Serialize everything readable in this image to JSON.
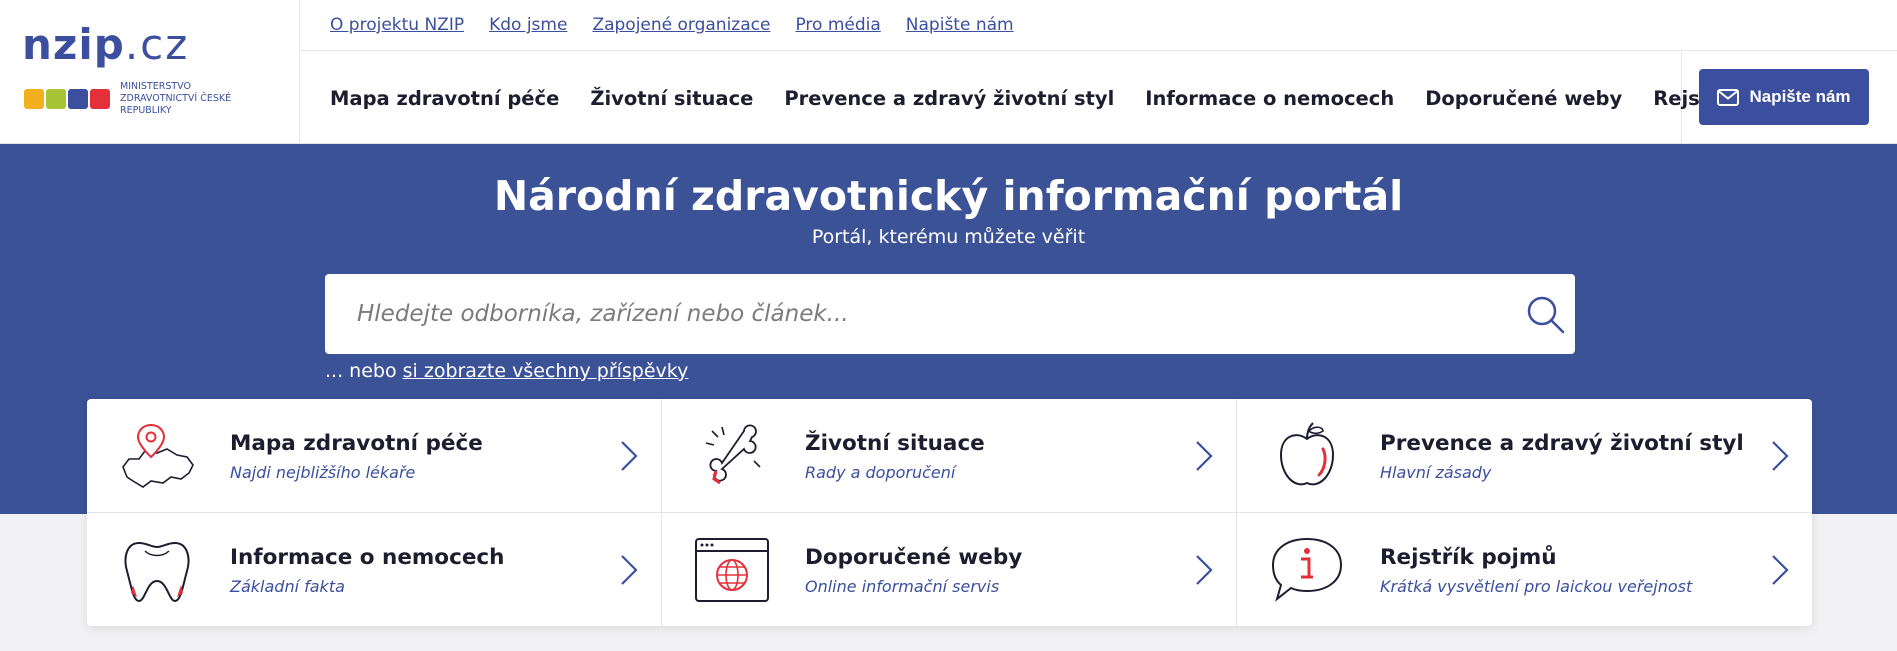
{
  "logo": {
    "name": "nzip",
    "domain": ".cz",
    "ministry": "Ministerstvo zdravotnictví České republiky"
  },
  "top_links": [
    "O projektu NZIP",
    "Kdo jsme",
    "Zapojené organizace",
    "Pro média",
    "Napište nám"
  ],
  "main_nav": [
    "Mapa zdravotní péče",
    "Životní situace",
    "Prevence a zdravý životní styl",
    "Informace o nemocech",
    "Doporučené weby",
    "Rejstřík pojmů"
  ],
  "contact_button": "Napište nám",
  "hero": {
    "title": "Národní zdravotnický informační portál",
    "subtitle": "Portál, kterému můžete věřit",
    "search_placeholder": "Hledejte odborníka, zařízení nebo článek...",
    "or_prefix": "... nebo ",
    "or_link": "si zobrazte všechny příspěvky"
  },
  "tiles": [
    {
      "title": "Mapa zdravotní péče",
      "subtitle": "Najdi nejbližšího lékaře",
      "icon": "map-pin-icon"
    },
    {
      "title": "Životní situace",
      "subtitle": "Rady a doporučení",
      "icon": "bone-icon"
    },
    {
      "title": "Prevence a zdravý životní styl",
      "subtitle": "Hlavní zásady",
      "icon": "apple-icon"
    },
    {
      "title": "Informace o nemocech",
      "subtitle": "Základní fakta",
      "icon": "tooth-icon"
    },
    {
      "title": "Doporučené weby",
      "subtitle": "Online informační servis",
      "icon": "web-globe-icon"
    },
    {
      "title": "Rejstřík pojmů",
      "subtitle": "Krátká vysvětlení pro laickou veřejnost",
      "icon": "info-bubble-icon"
    }
  ],
  "colors": {
    "brand_blue": "#3b4f9e",
    "hero_bg": "#3c5297",
    "accent_red": "#e3303b"
  }
}
